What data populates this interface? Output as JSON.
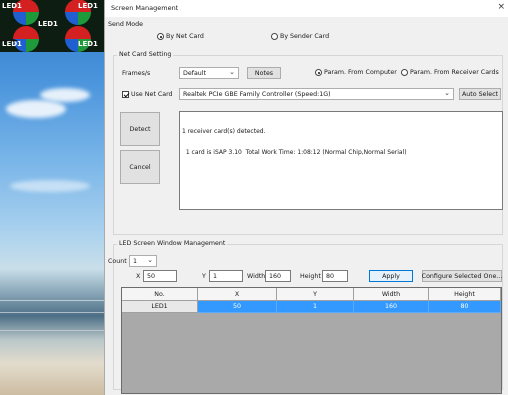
{
  "led_preview": {
    "labels": [
      "LED1",
      "LED1",
      "LED1",
      "LED1",
      "LED1"
    ]
  },
  "window": {
    "title": "Screen Management",
    "close_label": "×"
  },
  "send_mode": {
    "label": "Send Mode",
    "options": [
      {
        "label": "By Net Card",
        "selected": true
      },
      {
        "label": "By Sender Card",
        "selected": false
      }
    ]
  },
  "net_card_setting": {
    "title": "Net Card Setting",
    "frame_label": "Frames/s",
    "frame_value": "Default",
    "notes_button": "Notes",
    "param_options": [
      {
        "label": "Param. From Computer",
        "selected": true
      },
      {
        "label": "Param. From Receiver Cards",
        "selected": false
      }
    ],
    "use_net_card_label": "Use Net Card",
    "use_net_card_checked": true,
    "net_card_value": "Realtek PCIe GBE Family Controller (Speed:1G)",
    "auto_select_button": "Auto Select",
    "detect_button": "Detect",
    "cancel_button": "Cancel",
    "log_lines": [
      "1 receiver card(s) detected.",
      "  1 card is iSAP 3.10  Total Work Time: 1:08:12 (Normal Chip,Normal Serial)"
    ]
  },
  "led_window_mgmt": {
    "title": "LED Screen Window Management",
    "count_label": "Count",
    "count_value": "1",
    "x_label": "X",
    "x_value": "50",
    "y_label": "Y",
    "y_value": "1",
    "width_label": "Width",
    "width_value": "160",
    "height_label": "Height",
    "height_value": "80",
    "apply_button": "Apply",
    "configure_button": "Configure Selected One...",
    "columns": [
      "No.",
      "X",
      "Y",
      "Width",
      "Height"
    ],
    "rows": [
      [
        "LED1",
        "50",
        "1",
        "160",
        "80"
      ]
    ]
  }
}
